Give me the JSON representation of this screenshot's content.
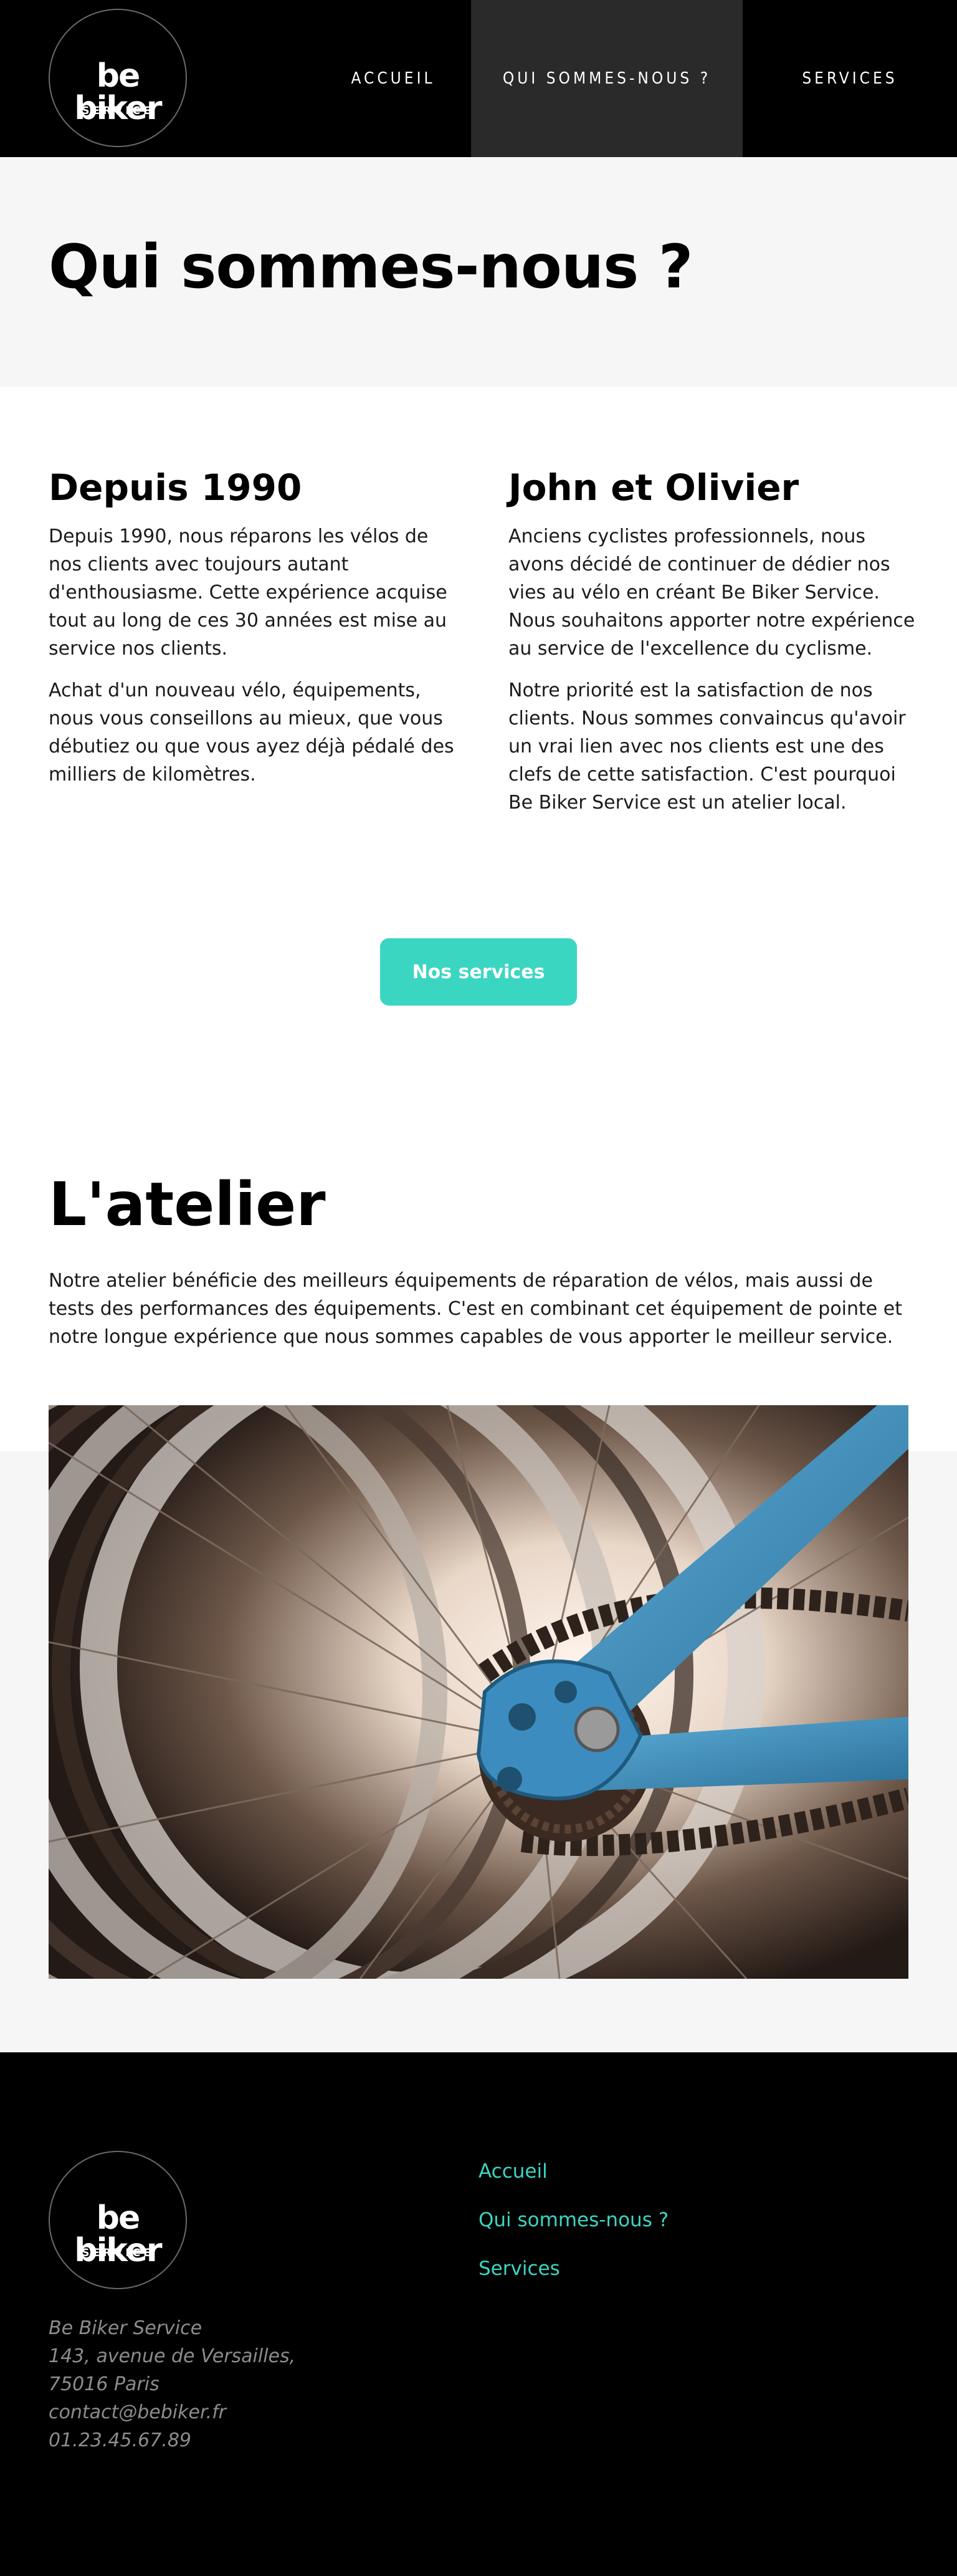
{
  "header": {
    "logo_text": "be biker",
    "logo_sub": "SERVICE",
    "nav": [
      "ACCUEIL",
      "QUI SOMMES-NOUS ?",
      "SERVICES"
    ]
  },
  "hero": {
    "title": "Qui sommes-nous ?"
  },
  "columns": [
    {
      "heading": "Depuis 1990",
      "paragraphs": [
        "Depuis 1990, nous réparons les vélos de nos clients avec toujours autant d'enthousiasme. Cette expérience acquise tout au long de ces 30 années est mise au service nos clients.",
        "Achat d'un nouveau vélo, équipements, nous vous conseillons au mieux, que vous débutiez ou que vous ayez déjà pédalé des milliers de kilomètres."
      ]
    },
    {
      "heading": "John et Olivier",
      "paragraphs": [
        "Anciens cyclistes professionnels, nous avons décidé de continuer de dédier nos vies au vélo en créant Be Biker Service. Nous souhaitons apporter notre expérience au service de l'excellence du cyclisme.",
        "Notre priorité est la satisfaction de nos clients. Nous sommes convaincus qu'avoir un vrai lien avec nos clients est une des clefs de cette satisfaction. C'est pourquoi Be Biker Service est un atelier local."
      ]
    }
  ],
  "cta": {
    "label": "Nos services"
  },
  "atelier": {
    "title": "L'atelier",
    "text": "Notre atelier bénéficie des meilleurs équipements de réparation de vélos, mais aussi de tests des performances des équipements. C'est en combinant cet équipement de pointe et notre longue expérience que nous sommes capables de vous apporter le meilleur service."
  },
  "footer": {
    "logo_text": "be biker",
    "logo_sub": "SERVICE",
    "address": [
      "Be Biker Service",
      "143, avenue de Versailles,",
      "75016 Paris",
      "contact@bebiker.fr",
      "01.23.45.67.89"
    ],
    "links": [
      "Accueil",
      "Qui sommes-nous ?",
      "Services"
    ]
  },
  "colors": {
    "accent": "#3bd6c2",
    "header_bg": "#000000",
    "nav_active_bg": "#2a2a2b",
    "band_bg": "#f6f6f6",
    "frame_blue": "#3f8fbf"
  }
}
